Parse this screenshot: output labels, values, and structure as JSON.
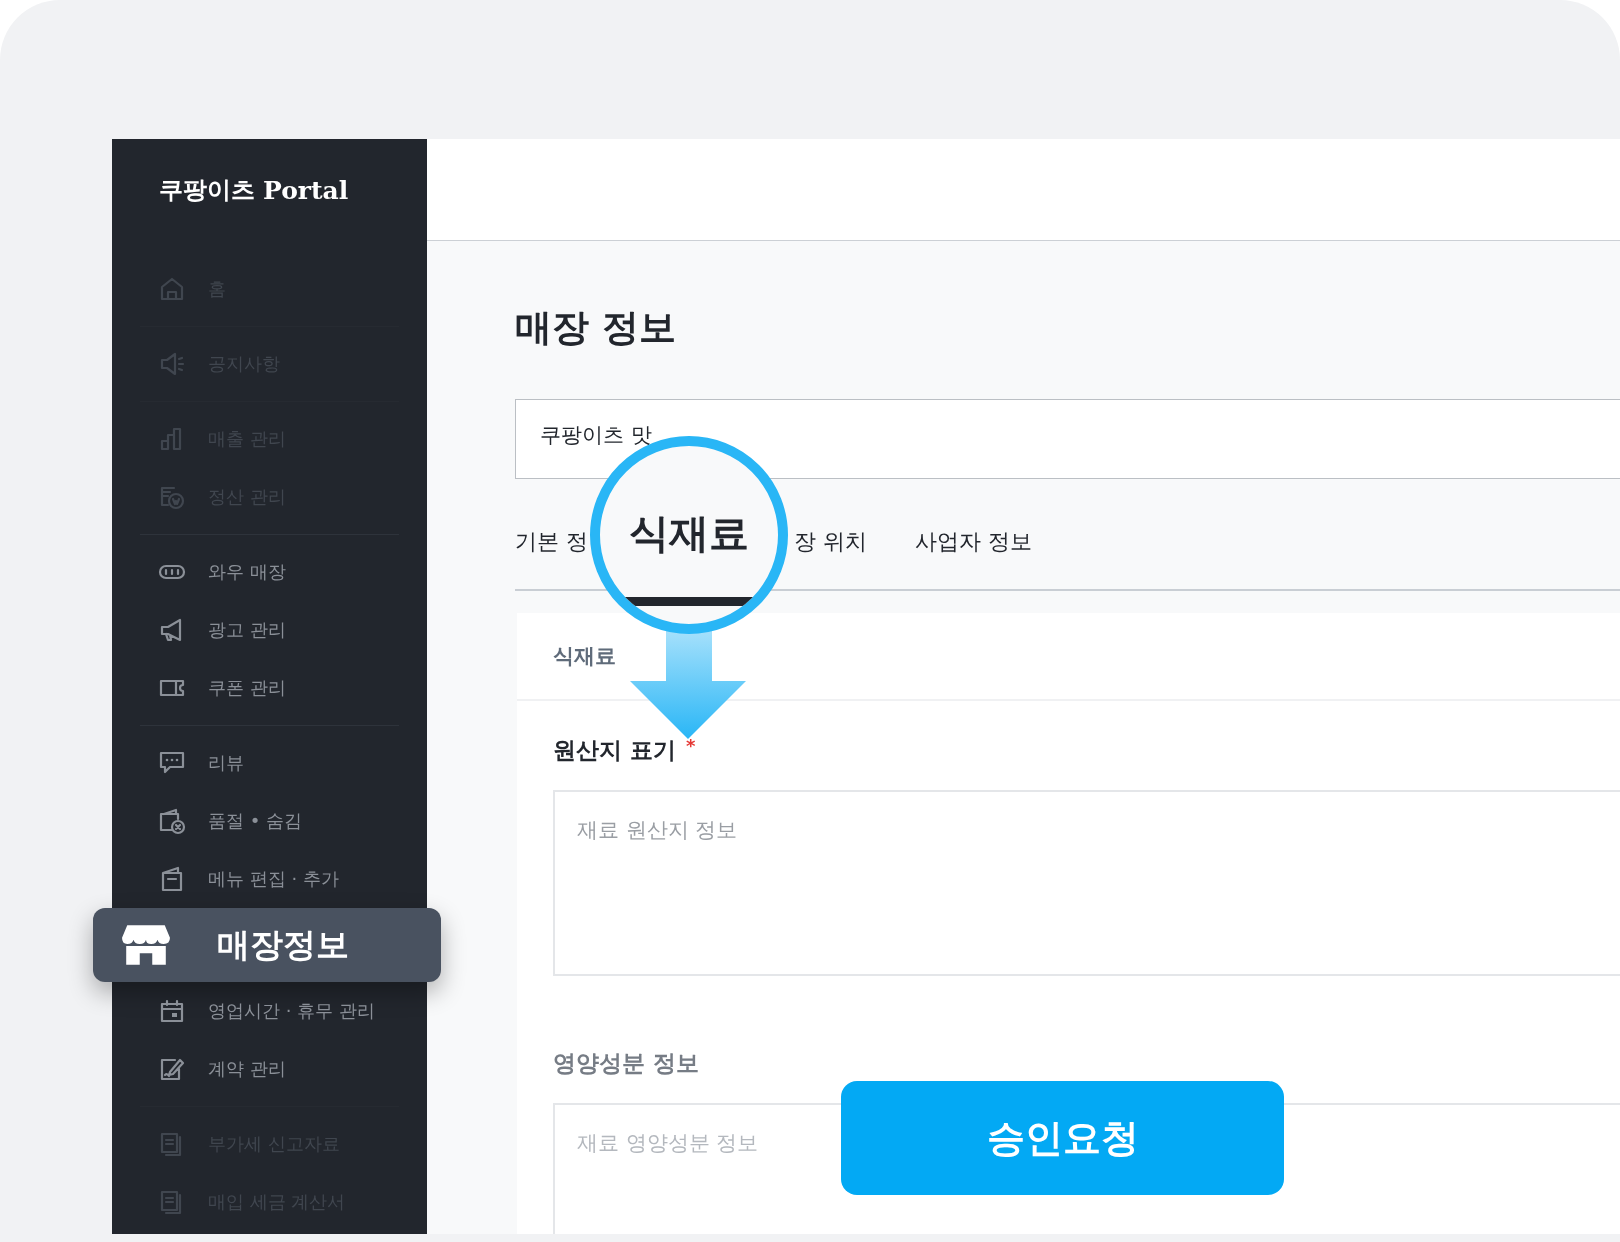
{
  "logo": {
    "brand": "쿠팡이츠",
    "product": "Portal"
  },
  "sidebar": {
    "groups": [
      [
        {
          "label": "홈",
          "dimmed": true,
          "selected": false
        }
      ],
      [
        {
          "label": "공지사항",
          "dimmed": true,
          "selected": false
        }
      ],
      [
        {
          "label": "매출 관리",
          "dimmed": true,
          "selected": false
        },
        {
          "label": "정산 관리",
          "dimmed": true,
          "selected": false
        }
      ],
      [
        {
          "label": "와우 매장",
          "dimmed": false,
          "selected": false
        },
        {
          "label": "광고 관리",
          "dimmed": false,
          "selected": false
        },
        {
          "label": "쿠폰 관리",
          "dimmed": false,
          "selected": false
        }
      ],
      [
        {
          "label": "리뷰",
          "dimmed": false,
          "selected": false
        },
        {
          "label": "품절 • 숨김",
          "dimmed": false,
          "selected": false
        },
        {
          "label": "메뉴 편집 · 추가",
          "dimmed": false,
          "selected": false
        },
        {
          "label": "매장정보",
          "dimmed": false,
          "selected": true
        },
        {
          "label": "영업시간 · 휴무 관리",
          "dimmed": false,
          "selected": false
        },
        {
          "label": "계약 관리",
          "dimmed": false,
          "selected": false
        }
      ],
      [
        {
          "label": "부가세 신고자료",
          "dimmed": true,
          "selected": false
        },
        {
          "label": "매입 세금 계산서",
          "dimmed": true,
          "selected": false
        }
      ]
    ]
  },
  "page_title": "매장 정보",
  "store_name": "쿠팡이츠 맛",
  "tabs": [
    {
      "label": "기본 정",
      "selected": false
    },
    {
      "label": "식재료",
      "selected": true
    },
    {
      "label": "장 위치",
      "selected": false
    },
    {
      "label": "사업자 정보",
      "selected": false
    }
  ],
  "section_title": "식재료",
  "fields": [
    {
      "label": "원산지 표기",
      "required_mark": "*",
      "placeholder": "재료 원산지 정보",
      "dimmed": false
    },
    {
      "label": "영양성분 정보",
      "placeholder": "재료 영양성분 정보",
      "dimmed": true
    }
  ],
  "submit_button": "승인요청"
}
